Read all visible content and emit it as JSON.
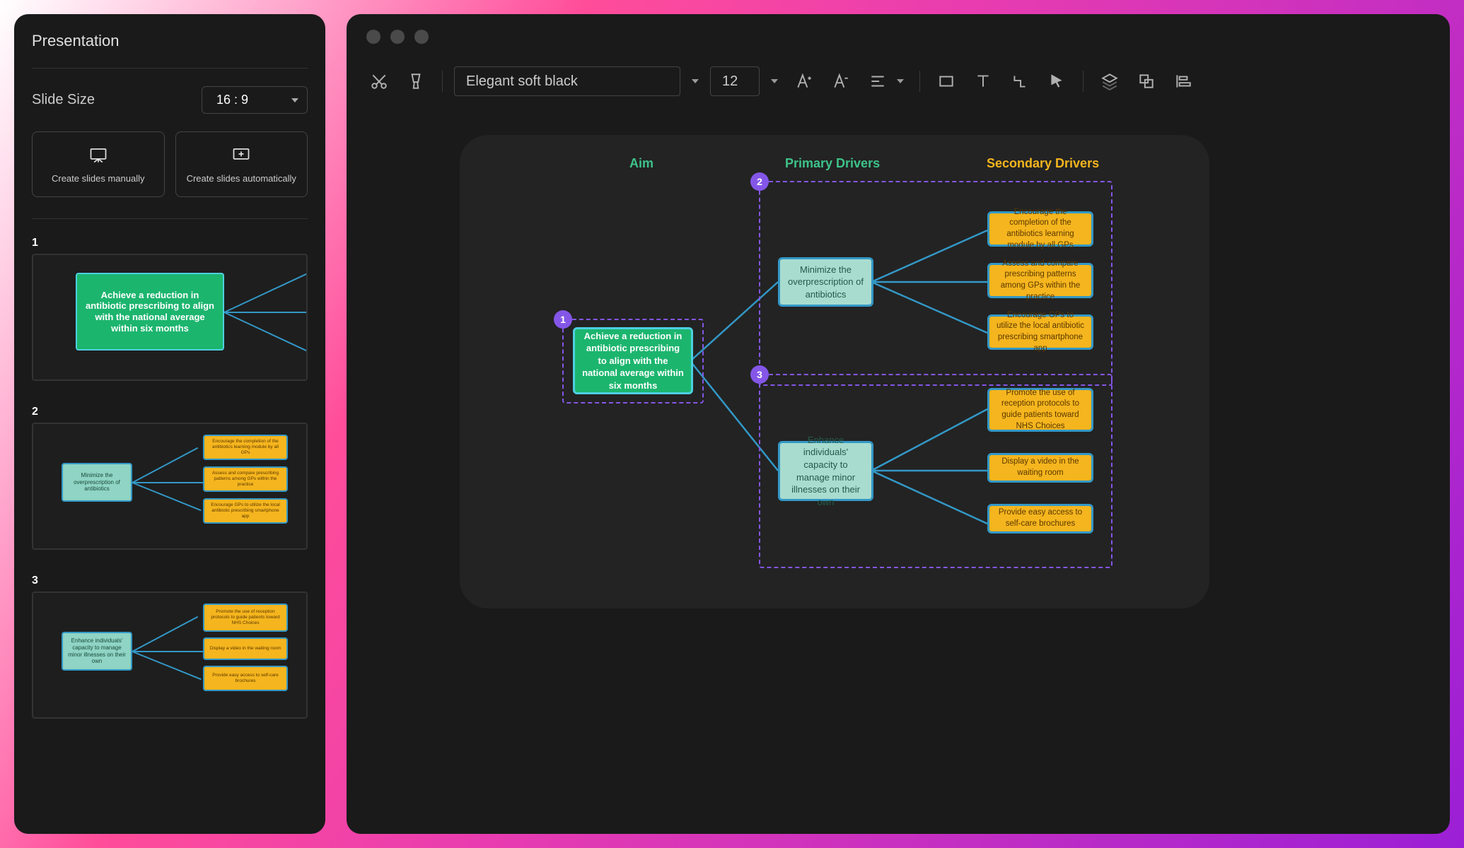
{
  "sidebar": {
    "title": "Presentation",
    "slide_size_label": "Slide Size",
    "slide_size_value": "16 : 9",
    "create_manual": "Create slides manually",
    "create_auto": "Create slides automatically",
    "thumbs": [
      "1",
      "2",
      "3"
    ]
  },
  "toolbar": {
    "style_value": "Elegant soft black",
    "font_size": "12"
  },
  "diagram": {
    "headers": {
      "aim": "Aim",
      "primary": "Primary Drivers",
      "secondary": "Secondary Drivers"
    },
    "badges": [
      "1",
      "2",
      "3"
    ],
    "aim": "Achieve a reduction in antibiotic prescribing to align with the national average within six months",
    "primary1": "Minimize the overprescription of antibiotics",
    "primary2": "Enhance individuals' capacity to manage minor illnesses on their own",
    "sec1a": "Encourage the completion of the antibiotics learning module by all GPs",
    "sec1b": "Assess and compare prescribing patterns among GPs within the practice",
    "sec1c": "Encourage GPs to utilize the local antibiotic prescribing smartphone app",
    "sec2a": "Promote the use of reception protocols to guide patients toward NHS Choices",
    "sec2b": "Display a video in the waiting room",
    "sec2c": "Provide easy access to self-care brochures"
  }
}
